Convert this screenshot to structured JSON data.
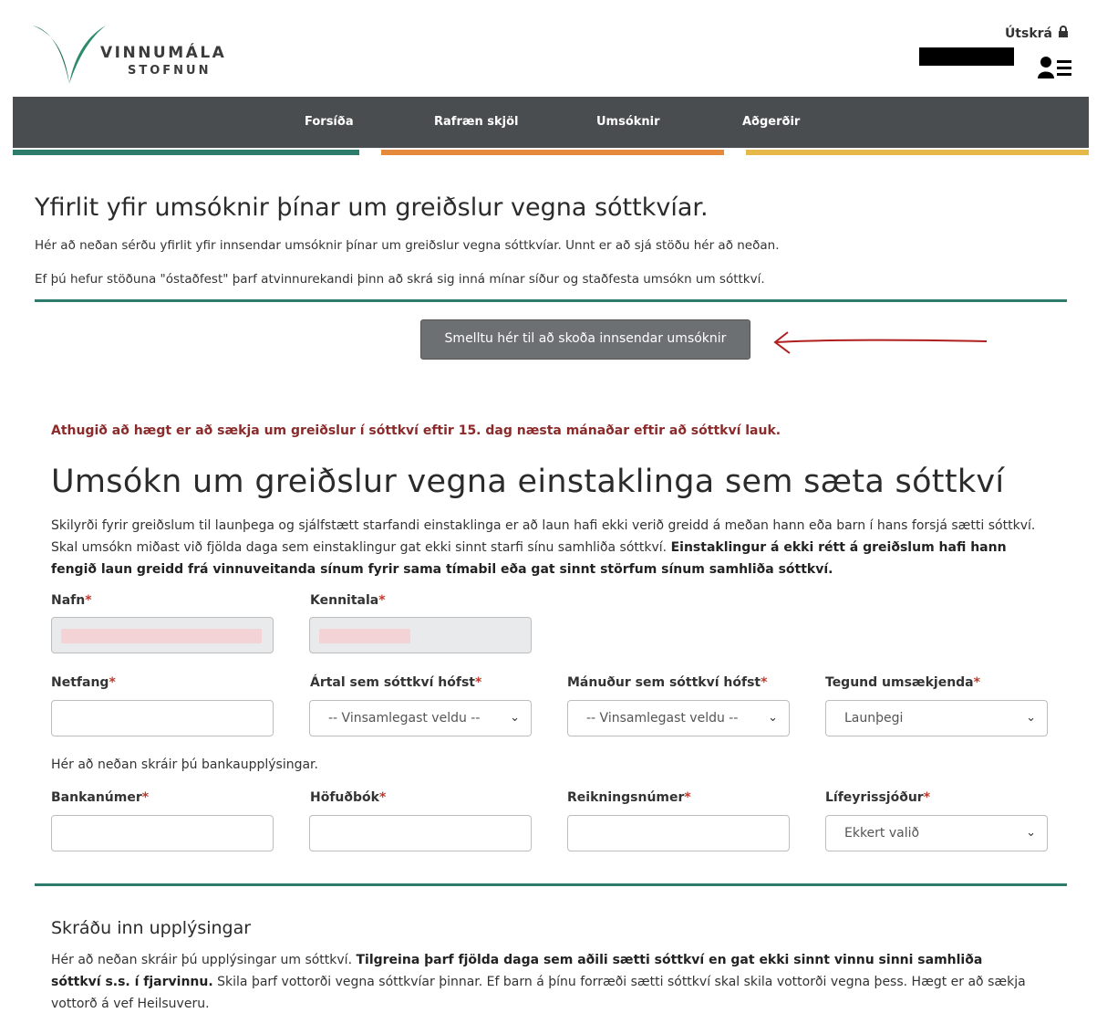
{
  "header": {
    "logo_line1": "VINNUMÁLA",
    "logo_line2": "STOFNUN",
    "logout_label": "Útskrá",
    "user_menu_icon": "user-list-icon"
  },
  "nav": {
    "items": [
      {
        "label": "Forsíða",
        "color": "#2d7b6a"
      },
      {
        "label": "Rafræn skjöl",
        "color": "#e58a3a"
      },
      {
        "label": "Umsóknir",
        "color": "#e58a3a"
      },
      {
        "label": "Aðgerðir",
        "color": "#e6b84a"
      }
    ]
  },
  "overview": {
    "title": "Yfirlit yfir umsóknir þínar um greiðslur vegna sóttkvíar.",
    "line1": "Hér að neðan sérðu yfirlit yfir innsendar umsóknir þínar um greiðslur vegna sóttkvíar. Unnt er að sjá stöðu hér að neðan.",
    "line2": "Ef þú hefur stöðuna \"óstaðfest\" þarf atvinnurekandi þinn að skrá sig inná mínar síður og staðfesta umsókn um sóttkví.",
    "view_button": "Smelltu hér til að skoða innsendar umsóknir"
  },
  "warning": "Athugið að hægt er að sækja um greiðslur í sóttkví eftir 15. dag næsta mánaðar eftir að sóttkví lauk.",
  "form": {
    "title": "Umsókn um greiðslur vegna einstaklinga sem sæta sóttkví",
    "desc_normal": "Skilyrði fyrir greiðslum til launþega og sjálfstætt starfandi einstaklinga er að laun hafi ekki verið greidd á meðan hann eða barn í hans forsjá sætti sóttkví. Skal umsókn miðast við fjölda daga sem einstaklingur gat ekki sinnt starfi sínu samhliða sóttkví.",
    "desc_bold": "Einstaklingur á ekki rétt á greiðslum hafi hann fengið laun greidd frá vinnuveitanda sínum fyrir sama tímabil eða gat sinnt störfum sínum samhliða sóttkví.",
    "name_label": "Nafn",
    "kennitala_label": "Kennitala",
    "email_label": "Netfang",
    "year_label": "Ártal sem sóttkví hófst",
    "year_value": "-- Vinsamlegast veldu --",
    "month_label": "Mánuður sem sóttkví hófst",
    "month_value": "-- Vinsamlegast veldu --",
    "applicant_type_label": "Tegund umsækjenda",
    "applicant_type_value": "Launþegi",
    "bank_hint": "Hér að neðan skráir þú bankaupplýsingar.",
    "bank_label": "Bankanúmer",
    "ledger_label": "Höfuðbók",
    "account_label": "Reikningsnúmer",
    "pension_label": "Lífeyrissjóður",
    "pension_value": "Ekkert valið",
    "required_mark": "*"
  },
  "section2": {
    "title": "Skráðu inn upplýsingar",
    "desc_normal1": "Hér að neðan skráir þú upplýsingar um sóttkví.",
    "desc_bold": "Tilgreina þarf fjölda daga sem aðili sætti sóttkví en gat ekki sinnt vinnu sinni samhliða sóttkví s.s. í fjarvinnu.",
    "desc_normal2": "Skila þarf vottorði vegna sóttkvíar þinnar. Ef barn á þínu forræði sætti sóttkví skal skila vottorði vegna þess. Hægt er að sækja vottorð á vef Heilsuveru."
  }
}
